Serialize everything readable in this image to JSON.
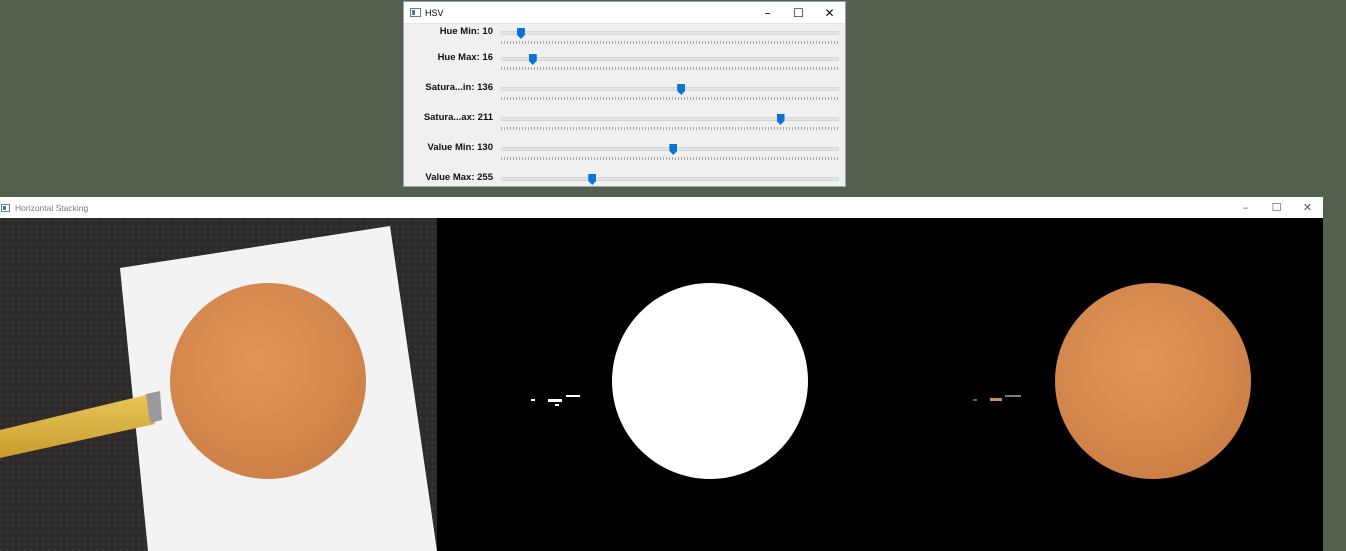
{
  "hsv_window": {
    "title": "HSV",
    "controls": {
      "minimize": "–",
      "maximize": "☐",
      "close": "✕"
    },
    "trackbars": [
      {
        "label": "Hue Min: 10",
        "fraction": 0.059
      },
      {
        "label": "Hue Max: 16",
        "fraction": 0.094
      },
      {
        "label": "Satura...in: 136",
        "fraction": 0.533
      },
      {
        "label": "Satura...ax: 211",
        "fraction": 0.827
      },
      {
        "label": "Value Min: 130",
        "fraction": 0.51
      },
      {
        "label": "Value Max: 255",
        "fraction": 0.27
      }
    ]
  },
  "stack_window": {
    "title": "Horizontal Stacking",
    "controls": {
      "minimize": "–",
      "maximize": "☐",
      "close": "✕"
    },
    "panels": [
      "original-frame",
      "binary-mask",
      "masked-result"
    ],
    "colors": {
      "ball": "#d8884c",
      "mask": "#ffffff",
      "background": "#000000",
      "paper": "#f2f2f2",
      "carpet": "#2f2d2c"
    }
  }
}
